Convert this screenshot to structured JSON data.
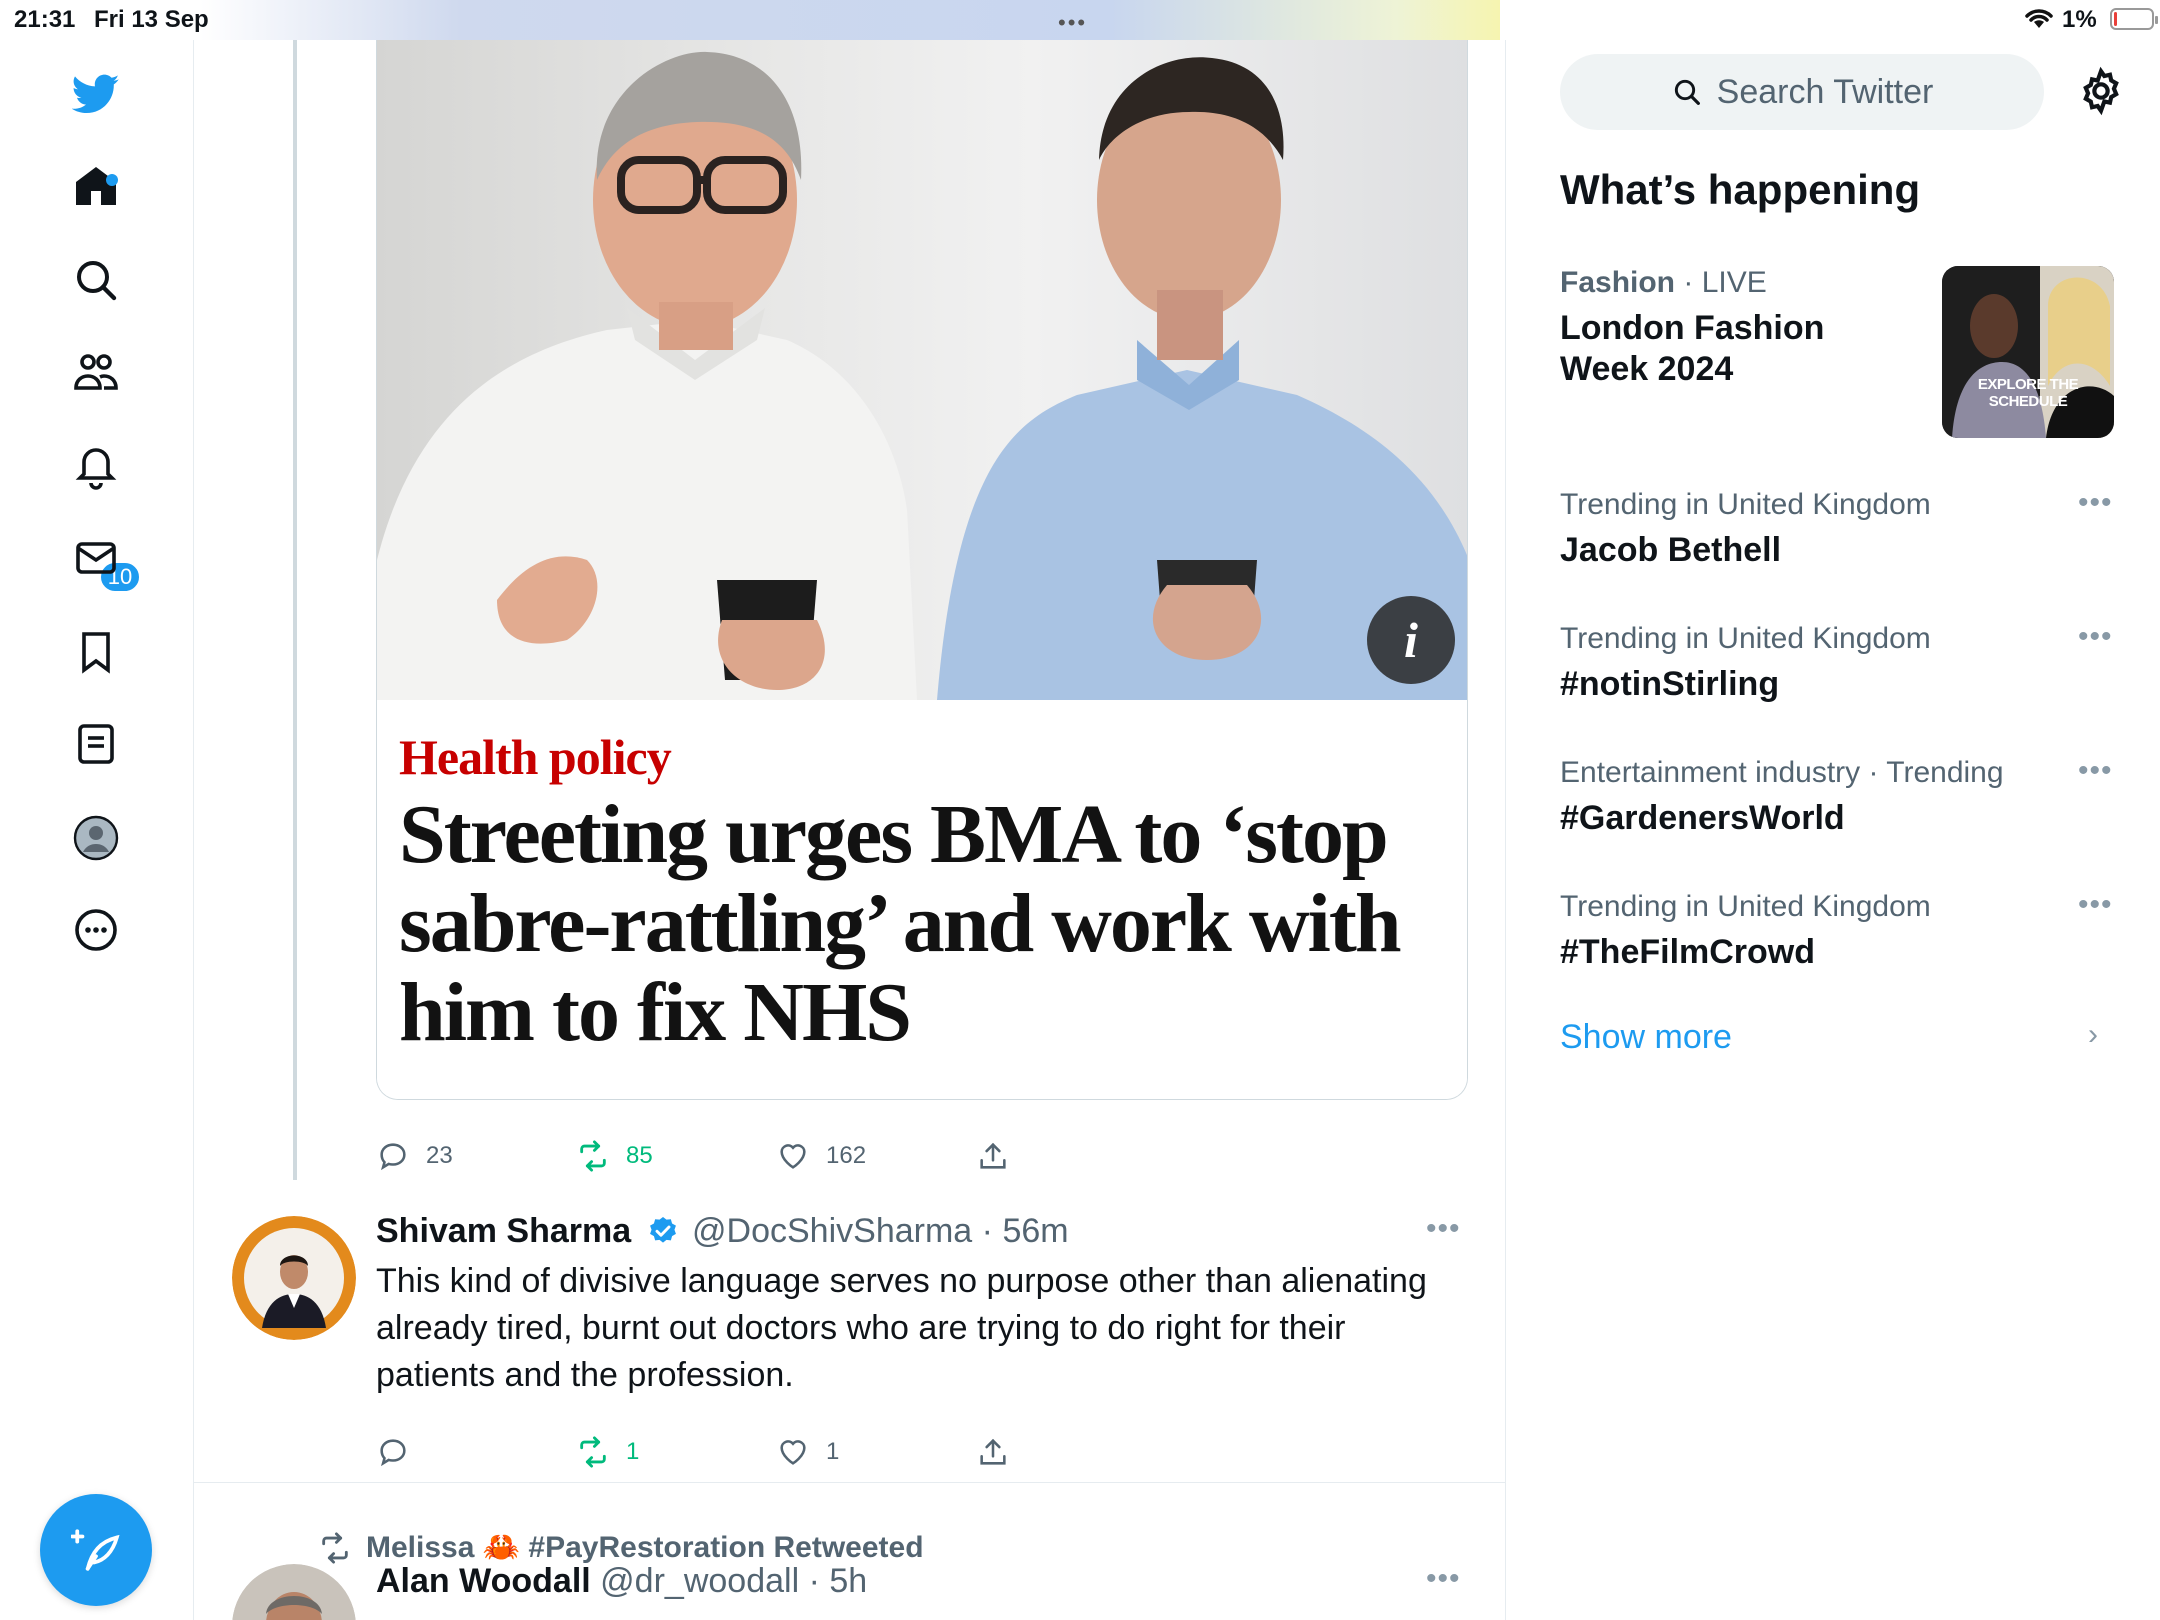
{
  "status_bar": {
    "time": "21:31",
    "date": "Fri 13 Sep",
    "battery": "1%",
    "battery_level_percent": 1
  },
  "nav": {
    "notifications_badge": "10",
    "icons": [
      "twitter-logo-icon",
      "home-icon",
      "search-icon",
      "communities-icon",
      "notifications-icon",
      "messages-icon",
      "bookmarks-icon",
      "lists-icon",
      "profile-icon",
      "more-icon",
      "compose-icon"
    ],
    "brand_color": "#1d9bf0"
  },
  "article_card": {
    "kicker": "Health policy",
    "headline": "Streeting urges BMA to ‘stop sabre-rattling’ and work with him to fix NHS",
    "kicker_color": "#c70000"
  },
  "tweet1_actions": {
    "replies": "23",
    "retweets": "85",
    "likes": "162"
  },
  "tweet2": {
    "name": "Shivam Sharma",
    "handle": "@DocShivSharma",
    "time": "56m",
    "text": "This kind of divisive language serves no purpose other than alienating already tired, burnt out doctors who are trying to do right for their patients and the profession.",
    "replies": "",
    "retweets": "1",
    "likes": "1"
  },
  "tweet3": {
    "retweeted_by": "Melissa 🦀 #PayRestoration Retweeted",
    "name": "Alan Woodall",
    "handle": "@dr_woodall",
    "time": "5h"
  },
  "sidebar": {
    "search_placeholder": "Search Twitter",
    "heading": "What’s happening",
    "featured": {
      "category": "Fashion",
      "status": "LIVE",
      "title": "London Fashion Week 2024",
      "image_text": "EXPLORE THE SCHEDULE"
    },
    "trends": [
      {
        "context": "Trending in United Kingdom",
        "title": "Jacob Bethell"
      },
      {
        "context": "Trending in United Kingdom",
        "title": "#notinStirling"
      },
      {
        "context": "Entertainment industry · Trending",
        "title": "#GardenersWorld"
      },
      {
        "context": "Trending in United Kingdom",
        "title": "#TheFilmCrowd"
      }
    ],
    "show_more": "Show more"
  }
}
